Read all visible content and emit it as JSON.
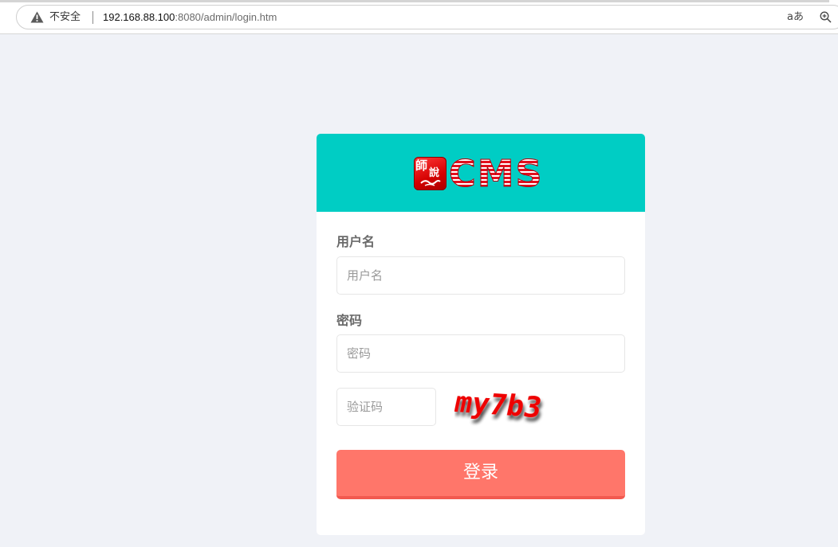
{
  "browser": {
    "security_label": "不安全",
    "url_host": "192.168.88.100",
    "url_rest": ":8080/admin/login.htm",
    "read_aloud_glyph": "aあ"
  },
  "login": {
    "logo_badge_char_1": "師",
    "logo_badge_char_2": "說",
    "logo_text": "CMS",
    "username_label": "用户名",
    "username_placeholder": "用户名",
    "password_label": "密码",
    "password_placeholder": "密码",
    "captcha_placeholder": "验证码",
    "captcha_text": "my7b3",
    "submit_label": "登录"
  },
  "colors": {
    "header_bg": "#00cdc4",
    "button_bg": "#ff766a",
    "page_bg": "#f0f2f7",
    "captcha_red": "#ee0000"
  }
}
